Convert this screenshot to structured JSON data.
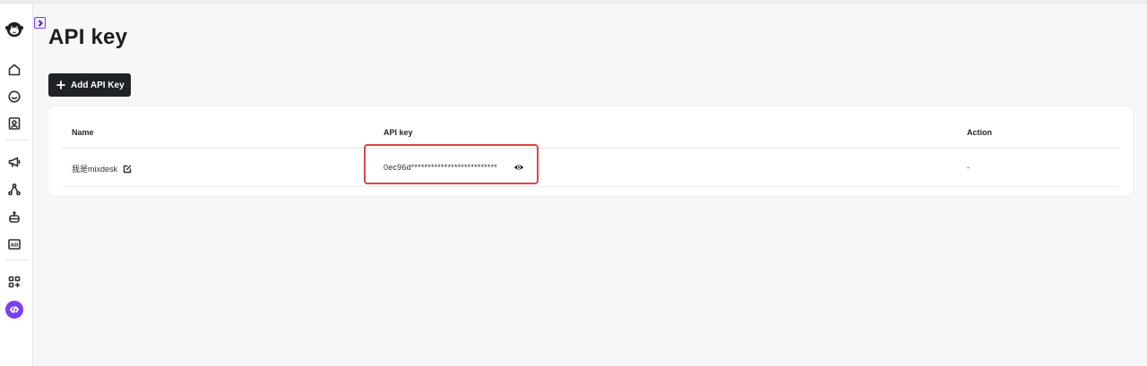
{
  "page": {
    "title": "API key",
    "add_button_label": "Add API Key"
  },
  "sidebar": {
    "items": [
      {
        "name": "logo",
        "icon": "monkey-logo-icon"
      },
      {
        "name": "home",
        "icon": "home-icon"
      },
      {
        "name": "chat",
        "icon": "chat-bubble-icon"
      },
      {
        "name": "contacts",
        "icon": "contact-card-icon"
      },
      {
        "name": "marketing",
        "icon": "megaphone-icon"
      },
      {
        "name": "flows",
        "icon": "flow-nodes-icon"
      },
      {
        "name": "bot",
        "icon": "robot-icon"
      },
      {
        "name": "ads",
        "icon": "ad-icon"
      },
      {
        "name": "apps",
        "icon": "apps-add-icon"
      },
      {
        "name": "developer",
        "icon": "code-icon",
        "active": true
      }
    ],
    "active_color": "#7a3ff2"
  },
  "table": {
    "columns": [
      "Name",
      "API key",
      "Action"
    ],
    "rows": [
      {
        "name": "我是mixdesk",
        "api_key": "0ec96d**************************",
        "action": "-"
      }
    ]
  },
  "colors": {
    "highlight_border": "#e04545",
    "button_bg": "#1f2226",
    "accent": "#7a3ff2"
  }
}
